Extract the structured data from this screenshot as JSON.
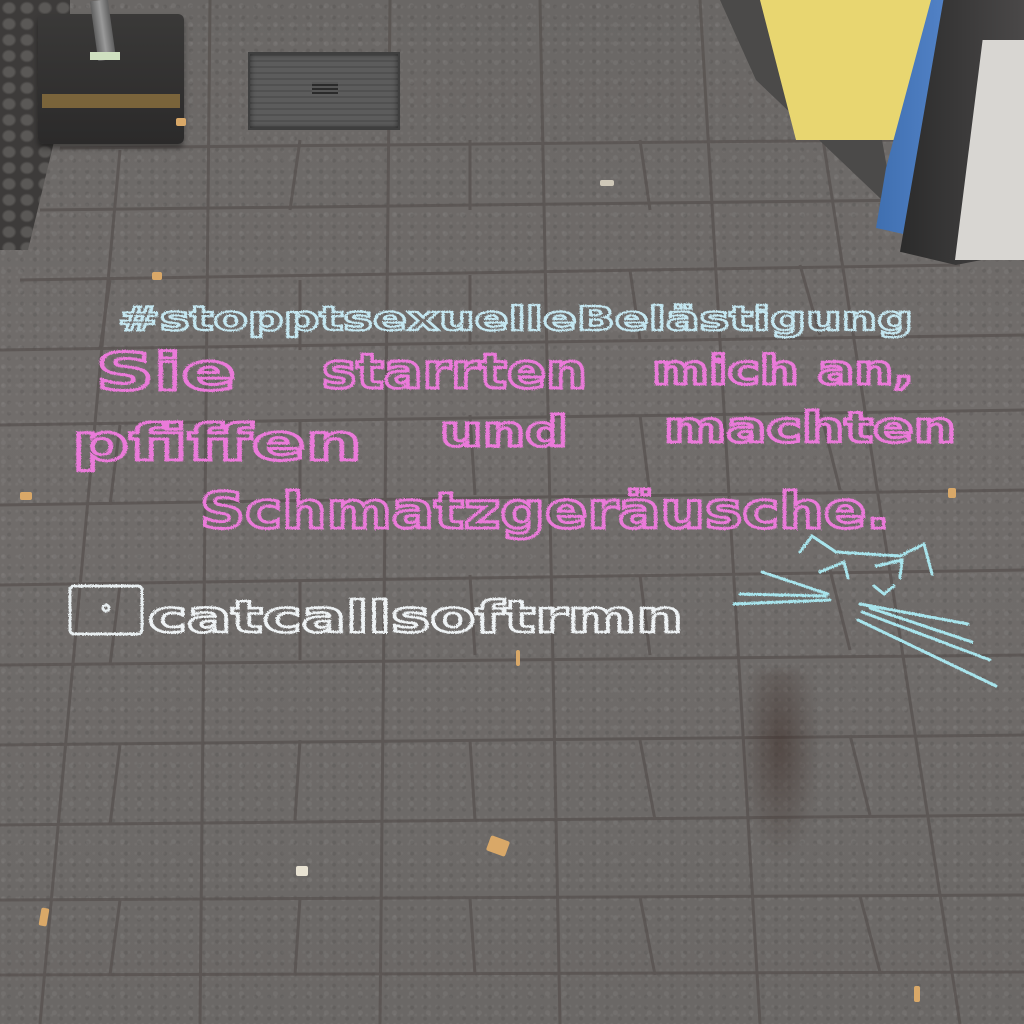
{
  "scene": {
    "colors": {
      "pavement": "#6e6b69",
      "chalk_light_blue": "#b8e4ee",
      "chalk_pink": "#e87ad8",
      "wall_yellow": "#e8d670",
      "wall_blue": "#4a7cc0"
    }
  },
  "chalk": {
    "hashtag": "#stopptsexuelleBelästigung",
    "line1_a": "Sie",
    "line1_b": "starrten",
    "line1_c": "mich an,",
    "line2_a": "pfiffen",
    "line2_b": "und",
    "line2_c": "machten",
    "line3": "Schmatzgeräusche.",
    "handle": "catcallsoftrmn",
    "handle_icon": "instagram-icon",
    "drawing": "cat-drawing"
  }
}
